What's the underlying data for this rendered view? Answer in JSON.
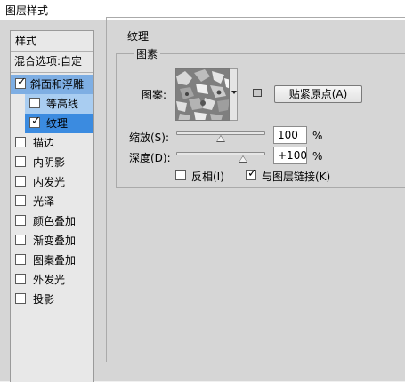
{
  "window": {
    "title": "图层样式"
  },
  "sidebar": {
    "header": "样式",
    "blending_options": "混合选项:自定",
    "items": [
      {
        "label": "斜面和浮雕",
        "checked": true,
        "state": "selected-parent"
      },
      {
        "label": "等高线",
        "checked": false,
        "state": "selected-sub"
      },
      {
        "label": "纹理",
        "checked": true,
        "state": "active"
      },
      {
        "label": "描边",
        "checked": false
      },
      {
        "label": "内阴影",
        "checked": false
      },
      {
        "label": "内发光",
        "checked": false
      },
      {
        "label": "光泽",
        "checked": false
      },
      {
        "label": "颜色叠加",
        "checked": false
      },
      {
        "label": "渐变叠加",
        "checked": false
      },
      {
        "label": "图案叠加",
        "checked": false
      },
      {
        "label": "外发光",
        "checked": false
      },
      {
        "label": "投影",
        "checked": false
      }
    ],
    "check_mark": "✓"
  },
  "texture": {
    "section_title": "纹理",
    "group_title": "图素",
    "pattern_label": "图案:",
    "snap_button": "贴紧原点(A)",
    "scale_label": "缩放(S):",
    "scale_value": "100",
    "scale_unit": "%",
    "scale_fraction": 0.5,
    "depth_label": "深度(D):",
    "depth_value": "+100",
    "depth_unit": "%",
    "depth_fraction": 0.75,
    "invert_label": "反相(I)",
    "invert_checked": false,
    "link_label": "与图层链接(K)",
    "link_checked": true
  },
  "colors": {
    "selected_parent": "#7eaee3",
    "selected_sub": "#a9cdf1",
    "active": "#3b8be0",
    "panel_bg": "#d6d6d6"
  }
}
